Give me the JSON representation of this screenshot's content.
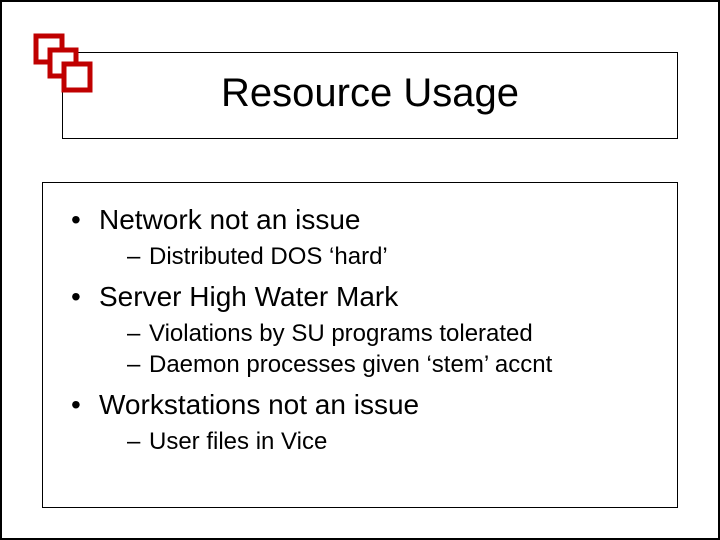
{
  "title": "Resource Usage",
  "bullets": [
    {
      "text": "Network not an issue",
      "sub": [
        "Distributed DOS ‘hard’"
      ]
    },
    {
      "text": "Server High Water Mark",
      "sub": [
        "Violations by SU programs tolerated",
        "Daemon processes given ‘stem’ accnt"
      ]
    },
    {
      "text": "Workstations not an issue",
      "sub": [
        "User files in Vice"
      ]
    }
  ]
}
